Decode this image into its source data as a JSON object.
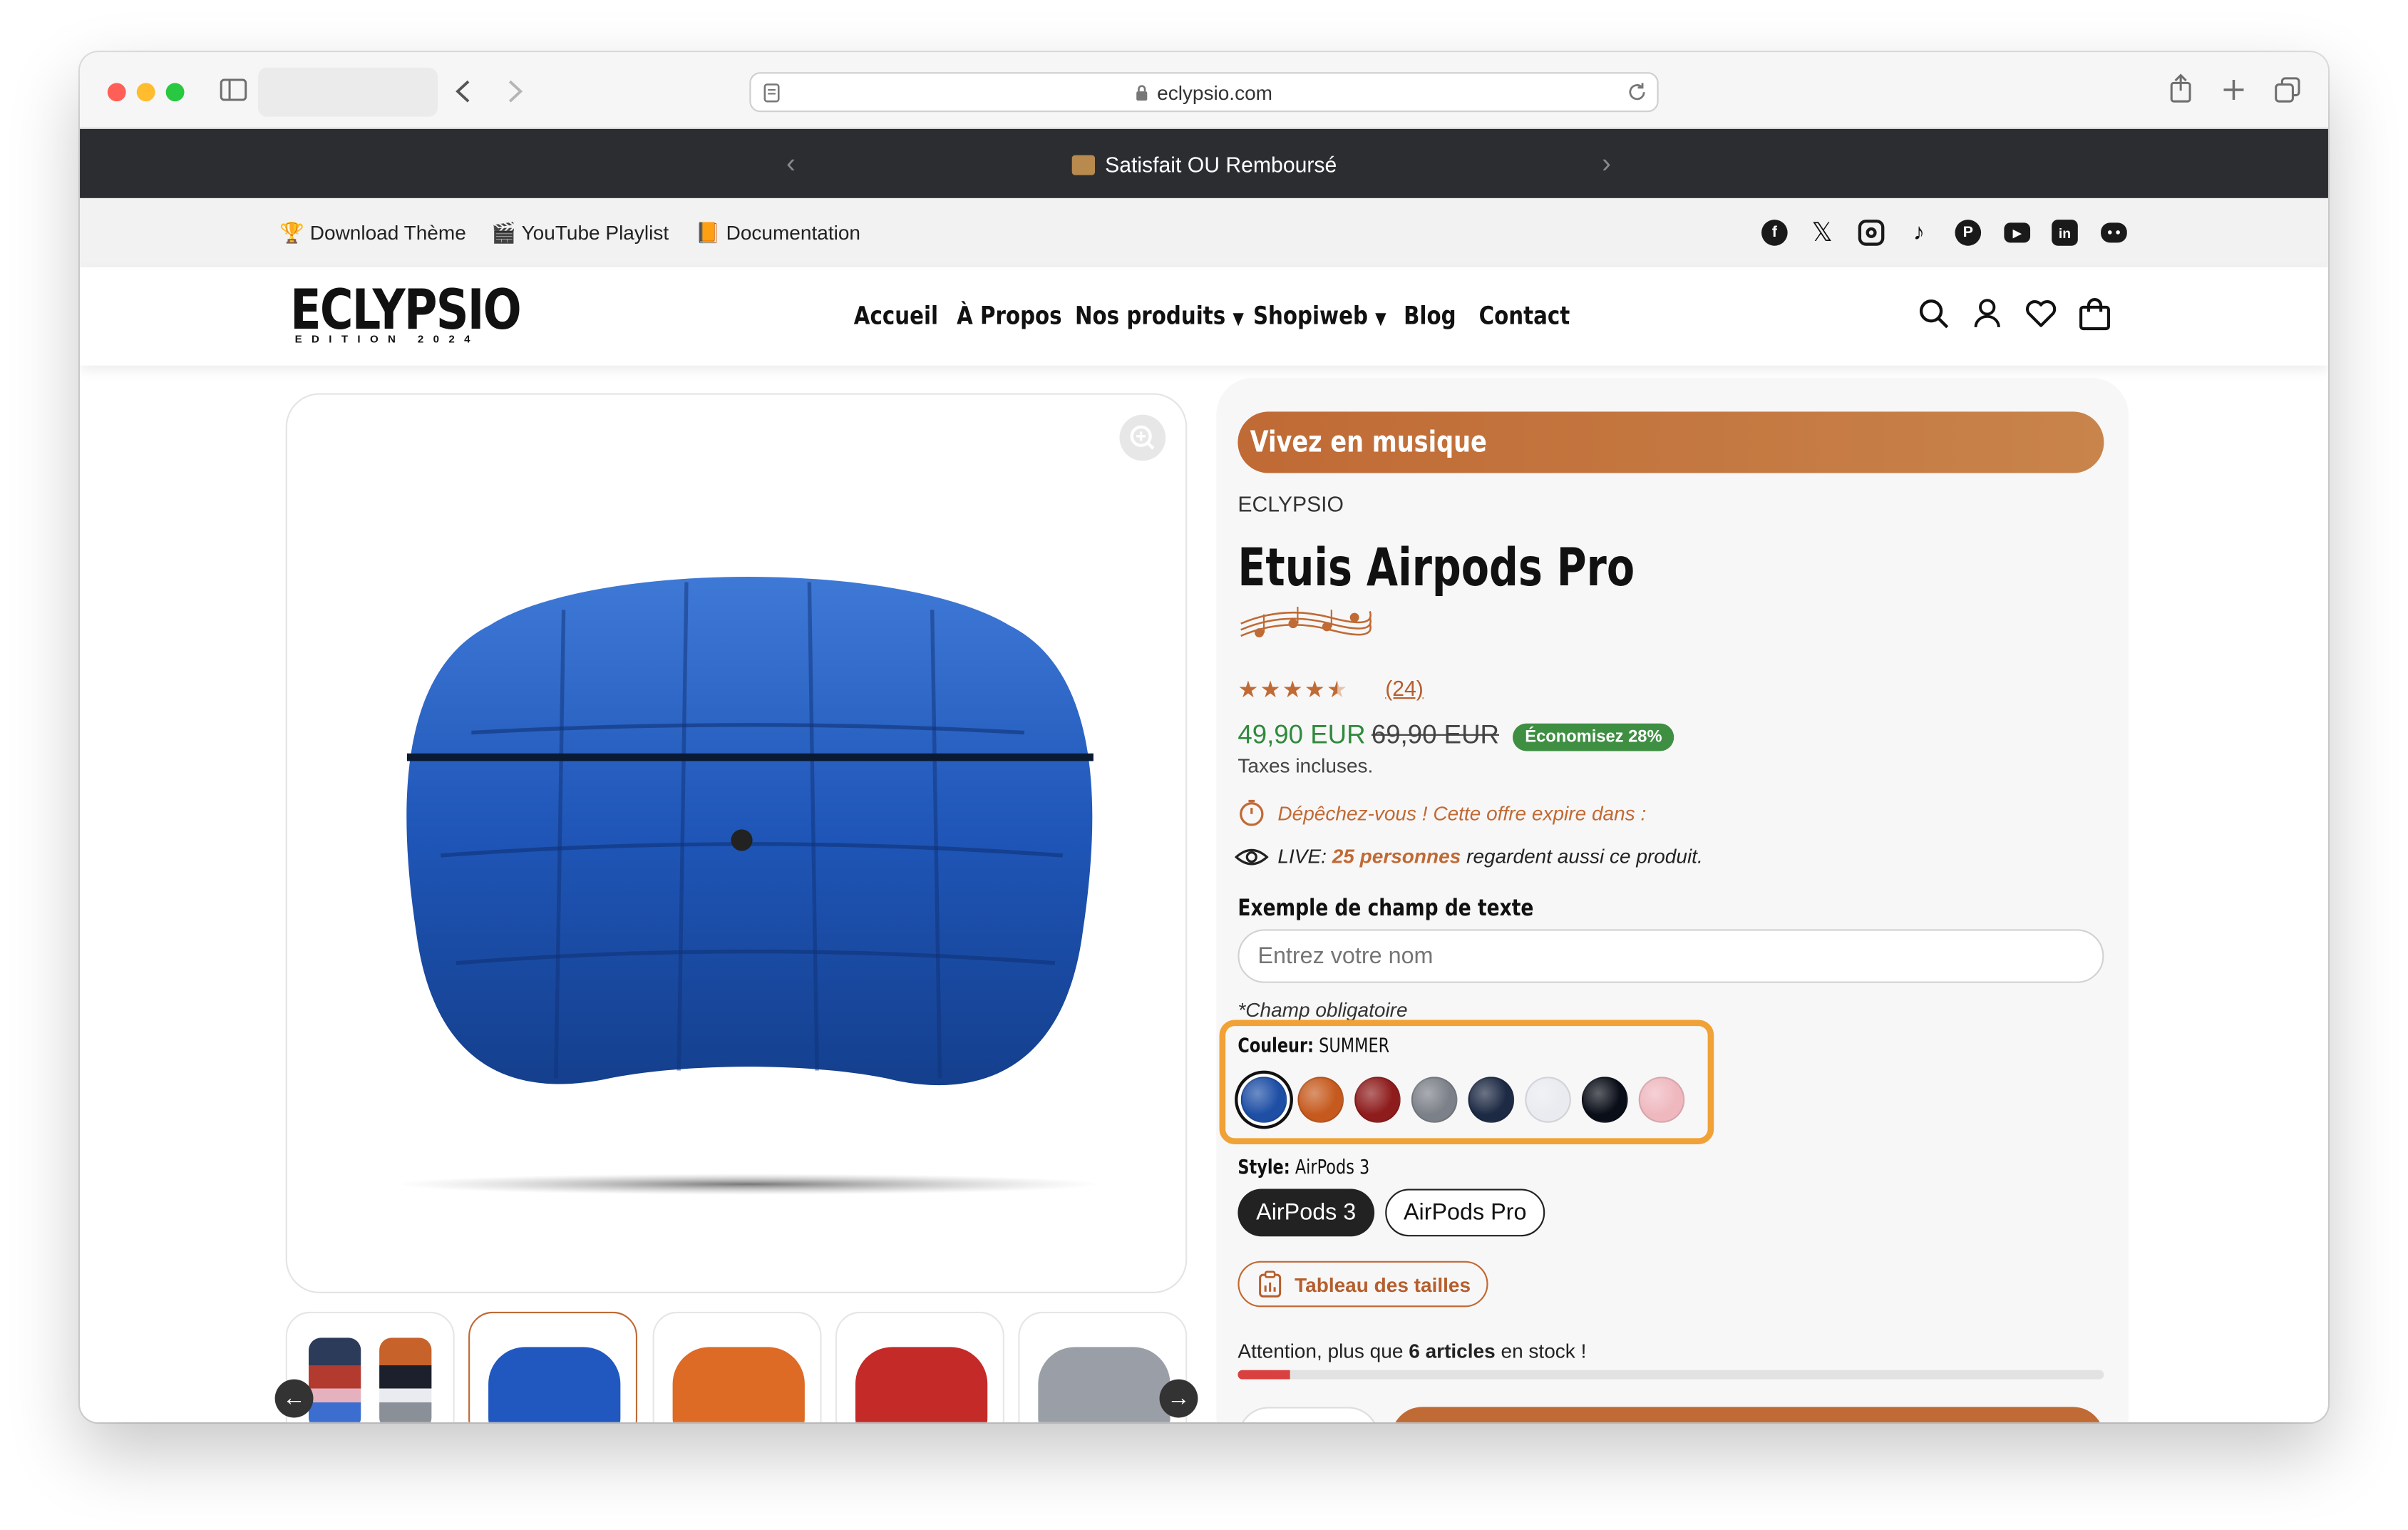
{
  "browser": {
    "url": "eclypsio.com"
  },
  "promo": {
    "icon": "package-icon",
    "text": "Satisfait OU Remboursé"
  },
  "utility": {
    "links": [
      {
        "icon": "trophy-icon",
        "label": "Download Thème"
      },
      {
        "icon": "clapper-icon",
        "label": "YouTube Playlist"
      },
      {
        "icon": "book-icon",
        "label": "Documentation"
      }
    ],
    "social": [
      "facebook-icon",
      "x-icon",
      "instagram-icon",
      "tiktok-icon",
      "pinterest-icon",
      "youtube-icon",
      "linkedin-icon",
      "discord-icon"
    ]
  },
  "header": {
    "logo": "ECLYPSIO",
    "logo_sub": "EDITION 2024",
    "nav": [
      "Accueil",
      "À Propos",
      "Nos produits",
      "Shopiweb",
      "Blog",
      "Contact"
    ]
  },
  "product": {
    "tag": "Vivez en musique",
    "vendor": "ECLYPSIO",
    "title": "Etuis Airpods Pro",
    "rating": 4.5,
    "review_count": "(24)",
    "price": "49,90 EUR",
    "compare_price": "69,90 EUR",
    "discount_badge": "Économisez 28%",
    "tax_note": "Taxes incluses.",
    "timer_text": "Dépêchez-vous ! Cette offre expire dans :",
    "live_prefix": "LIVE:",
    "live_count": "25 personnes",
    "live_suffix": "regardent aussi ce produit.",
    "field_label": "Exemple de champ de texte",
    "field_placeholder": "Entrez votre nom",
    "field_required": "*Champ obligatoire",
    "color_label": "Couleur:",
    "color_value": "SUMMER",
    "colors": [
      "#1e4fa5",
      "#c65a1e",
      "#8e1c1c",
      "#7c8088",
      "#1d2a44",
      "#e9ebf0",
      "#0a0e18",
      "#efb8bf"
    ],
    "style_label": "Style:",
    "style_value": "AirPods 3",
    "styles": [
      "AirPods 3",
      "AirPods Pro"
    ],
    "size_chart": "Tableau des tailles",
    "stock_prefix": "Attention, plus que",
    "stock_count": "6 articles",
    "stock_suffix": "en stock !",
    "stock_level": 0.06
  },
  "accent": "#c06a35"
}
